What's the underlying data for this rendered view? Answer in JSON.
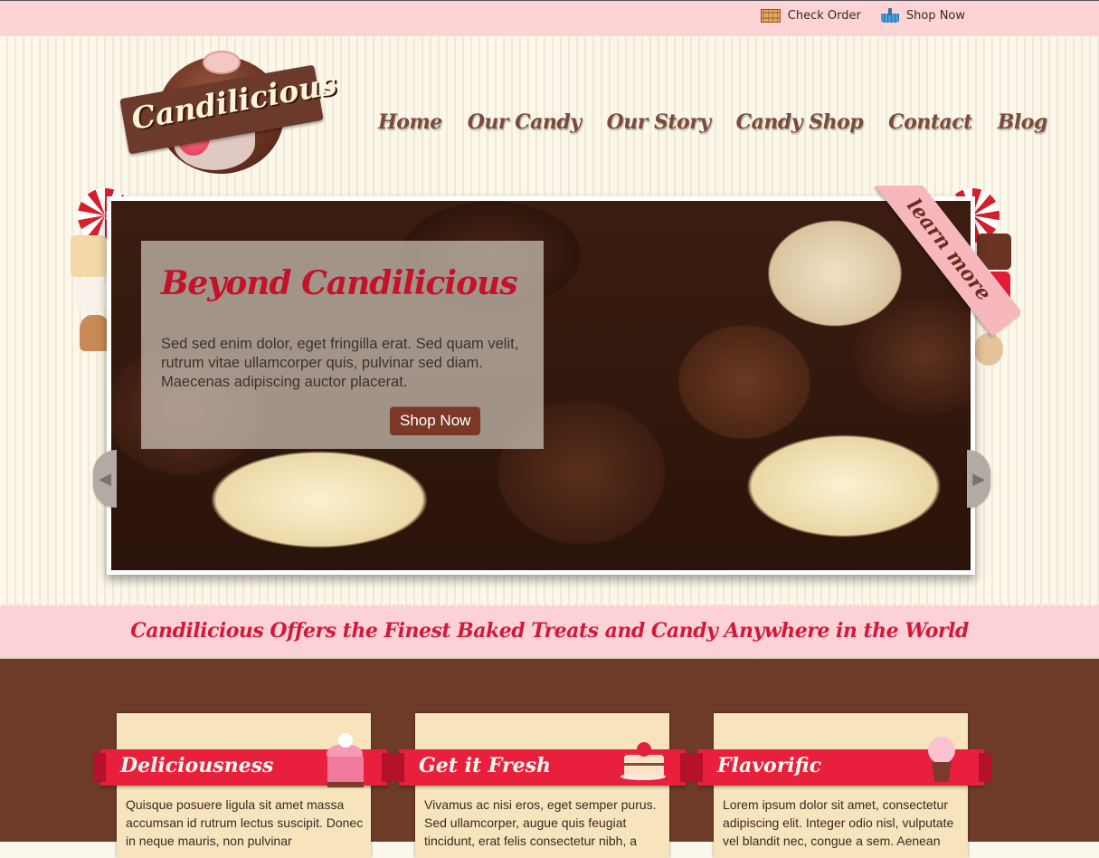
{
  "topbar": {
    "links": [
      {
        "label": "Check Order",
        "icon": "order-grid-icon"
      },
      {
        "label": "Shop Now",
        "icon": "basket-icon"
      }
    ]
  },
  "logo": {
    "text": "Candilicious"
  },
  "nav": {
    "items": [
      "Home",
      "Our Candy",
      "Our Story",
      "Candy Shop",
      "Contact",
      "Blog"
    ]
  },
  "slider": {
    "title": "Beyond Candilicious",
    "text": "Sed sed enim dolor, eget fringilla erat. Sed quam velit, rutrum vitae ullamcorper quis, pulvinar sed diam. Maecenas adipiscing auctor placerat.",
    "button": "Shop Now",
    "ribbon": "learn more",
    "prev_icon": "chevron-left-icon",
    "next_icon": "chevron-right-icon"
  },
  "tagline": "Candilicious Offers the Finest Baked Treats and Candy Anywhere in the World",
  "features": [
    {
      "title": "Deliciousness",
      "icon": "cake-slice-icon",
      "text": "Quisque posuere ligula sit amet massa accumsan id rutrum lectus suscipit. Donec in neque mauris, non pulvinar"
    },
    {
      "title": "Get it Fresh",
      "icon": "cherry-cake-icon",
      "text": "Vivamus ac nisi eros, eget semper purus. Sed ullamcorper, augue quis feugiat tincidunt, erat felis consectetur nibh, a"
    },
    {
      "title": "Flavorific",
      "icon": "cupcake-icon",
      "text": "Lorem ipsum dolor sit amet, consectetur adipiscing elit. Integer odio nisl, vulputate vel blandit nec, congue a sem. Aenean"
    }
  ],
  "colors": {
    "accent_red": "#e8203d",
    "brown": "#6e3b28",
    "pink": "#fcd2d7"
  }
}
